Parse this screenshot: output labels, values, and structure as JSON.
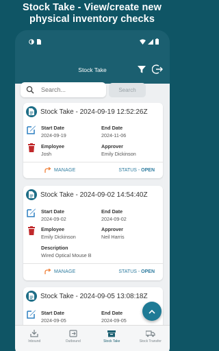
{
  "promo": {
    "line1": "Stock Take - View/create new",
    "line2": "physical inventory checks"
  },
  "status_bar": {
    "left_icons": [
      "circle-half-icon",
      "sim-card-icon"
    ],
    "right_icons": [
      "wifi-icon",
      "signal-icon",
      "battery-icon"
    ]
  },
  "app_bar": {
    "title": "Stock Take",
    "actions": [
      "filter-icon",
      "logout-icon"
    ]
  },
  "search": {
    "placeholder": "Search...",
    "button_label": "Search"
  },
  "cards": [
    {
      "title": "Stock Take - 2024-09-19 12:52:26Z",
      "start_date_label": "Start Date",
      "start_date": "2024-09-19",
      "end_date_label": "End Date",
      "end_date": "2024-11-06",
      "employee_label": "Employee",
      "employee": "Josh",
      "approver_label": "Approver",
      "approver": "Emily Dickinson",
      "manage_label": "MANAGE",
      "status_label": "STATUS - ",
      "status": "OPEN"
    },
    {
      "title": "Stock Take - 2024-09-02 14:54:40Z",
      "start_date_label": "Start Date",
      "start_date": "2024-09-02",
      "end_date_label": "End Date",
      "end_date": "2024-09-02",
      "employee_label": "Employee",
      "employee": "Emily Dickinson",
      "approver_label": "Approver",
      "approver": "Neil Harris",
      "description_label": "Description",
      "description": "Wired Optical Mouse B",
      "manage_label": "MANAGE",
      "status_label": "STATUS - ",
      "status": "OPEN"
    },
    {
      "title": "Stock Take - 2024-09-05 13:08:18Z",
      "start_date_label": "Start Date",
      "start_date": "2024-09-05",
      "end_date_label": "End Date",
      "end_date": "2024-09-05"
    }
  ],
  "bottom_nav": [
    {
      "label": "Inbound",
      "icon": "inbound-icon"
    },
    {
      "label": "Outbound",
      "icon": "outbound-icon"
    },
    {
      "label": "Stock Take",
      "icon": "stock-take-icon",
      "active": true
    },
    {
      "label": "Stock Transfer",
      "icon": "stock-transfer-icon"
    }
  ],
  "colors": {
    "brand": "#1b5f70",
    "accent": "#1e7a95",
    "delete": "#c0292b",
    "manage": "#f0813a",
    "edit": "#2b7fc1"
  }
}
